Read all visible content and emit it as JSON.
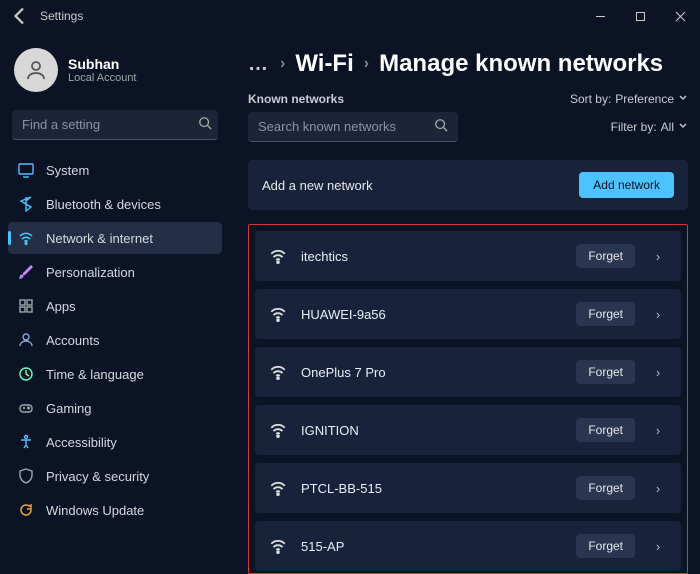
{
  "window": {
    "title": "Settings"
  },
  "profile": {
    "name": "Subhan",
    "sub": "Local Account"
  },
  "sidebar": {
    "search_placeholder": "Find a setting",
    "items": [
      {
        "label": "System"
      },
      {
        "label": "Bluetooth & devices"
      },
      {
        "label": "Network & internet"
      },
      {
        "label": "Personalization"
      },
      {
        "label": "Apps"
      },
      {
        "label": "Accounts"
      },
      {
        "label": "Time & language"
      },
      {
        "label": "Gaming"
      },
      {
        "label": "Accessibility"
      },
      {
        "label": "Privacy & security"
      },
      {
        "label": "Windows Update"
      }
    ]
  },
  "breadcrumb": {
    "dots": "…",
    "wifi": "Wi-Fi",
    "page": "Manage known networks"
  },
  "header": {
    "known_label": "Known networks",
    "sort_label": "Sort by:",
    "sort_value": "Preference",
    "search_placeholder": "Search known networks",
    "filter_label": "Filter by:",
    "filter_value": "All"
  },
  "add": {
    "label": "Add a new network",
    "button": "Add network"
  },
  "networks": [
    {
      "name": "itechtics",
      "action": "Forget"
    },
    {
      "name": "HUAWEI-9a56",
      "action": "Forget"
    },
    {
      "name": "OnePlus 7 Pro",
      "action": "Forget"
    },
    {
      "name": "IGNITION",
      "action": "Forget"
    },
    {
      "name": "PTCL-BB-515",
      "action": "Forget"
    },
    {
      "name": "515-AP",
      "action": "Forget"
    }
  ]
}
